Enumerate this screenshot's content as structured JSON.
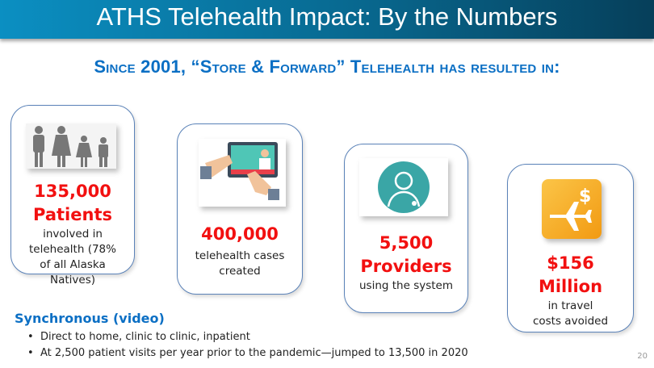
{
  "title": "ATHS Telehealth Impact: By the Numbers",
  "subtitle": "Since 2001, “Store & Forward” Telehealth has resulted in:",
  "cards": [
    {
      "number": "135,000",
      "unit": "Patients",
      "desc": "involved in telehealth (78% of all Alaska Natives)",
      "icon": "family-icon"
    },
    {
      "number": "400,000",
      "unit": "",
      "desc": "telehealth cases created",
      "icon": "tablet-doctor-icon"
    },
    {
      "number": "5,500",
      "unit": "Providers",
      "desc": "using the system",
      "icon": "provider-icon"
    },
    {
      "number": "$156",
      "unit": "Million",
      "desc": "in travel costs avoided",
      "icon": "plane-dollar-icon"
    }
  ],
  "sync": {
    "heading": "Synchronous (video)",
    "bullets": [
      "Direct to home, clinic to clinic, inpatient",
      "At 2,500 patient visits per year prior to the pandemic—jumped to 13,500 in 2020"
    ]
  },
  "page_number": "20",
  "colors": {
    "accent": "#0b6fc4",
    "stat": "#f21010"
  }
}
